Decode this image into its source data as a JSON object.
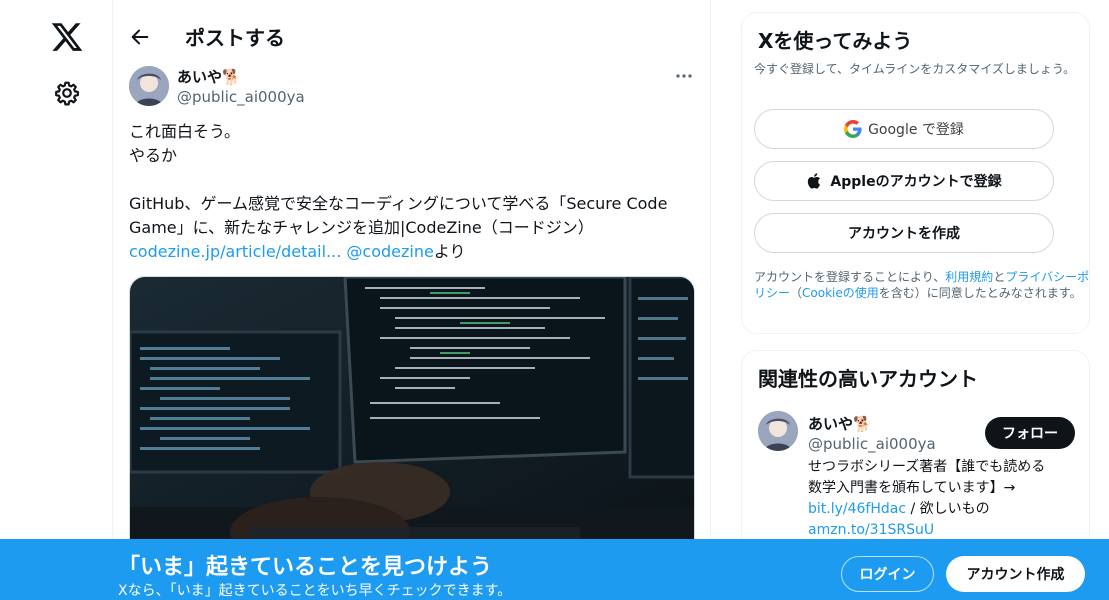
{
  "nav": {
    "logo_icon": "x-logo-icon",
    "settings_icon": "gear-icon"
  },
  "post_page": {
    "title": "ポストする",
    "author": {
      "name": "あいや🐕",
      "handle": "@public_ai000ya"
    },
    "text_lines": [
      "これ面白そう。",
      "やるか",
      "",
      "GitHub、ゲーム感覚で安全なコーディングについて学べる「Secure Code",
      "Game」に、新たなチャレンジを追加|CodeZine（コードジン）"
    ],
    "link_text": "codezine.jp/article/detail...",
    "mention": "@codezine",
    "suffix": "より"
  },
  "signup_card": {
    "title": "Xを使ってみよう",
    "subtitle": "今すぐ登録して、タイムラインをカスタマイズしましょう。",
    "google_label": "Google で登録",
    "apple_label": "Appleのアカウントで登録",
    "create_label": "アカウントを作成",
    "terms": {
      "prefix": "アカウントを登録することにより、",
      "tos": "利用規約",
      "and": "と",
      "privacy": "プライバシーポリシー",
      "open": "（",
      "cookie": "Cookieの使用",
      "rest": "を含む）に同意したとみなされます。"
    }
  },
  "related_card": {
    "title": "関連性の高いアカウント",
    "account": {
      "name": "あいや🐕",
      "handle": "@public_ai000ya",
      "follow_label": "フォロー",
      "bio_line1": "せつラボシリーズ著者【誰でも読める",
      "bio_line2": "数学入門書を頒布しています】→",
      "bio_link1": "bit.ly/46fHdac",
      "bio_mid": " / 欲しいもの",
      "bio_link2": "amzn.to/31SRSuU"
    }
  },
  "banner": {
    "title": "「いま」起きていることを見つけよう",
    "subtitle": "Xなら、「いま」起きていることをいち早くチェックできます。",
    "login_label": "ログイン",
    "signup_label": "アカウント作成"
  },
  "colors": {
    "accent": "#1d9bf0",
    "text": "#0f1419",
    "muted": "#536471"
  }
}
